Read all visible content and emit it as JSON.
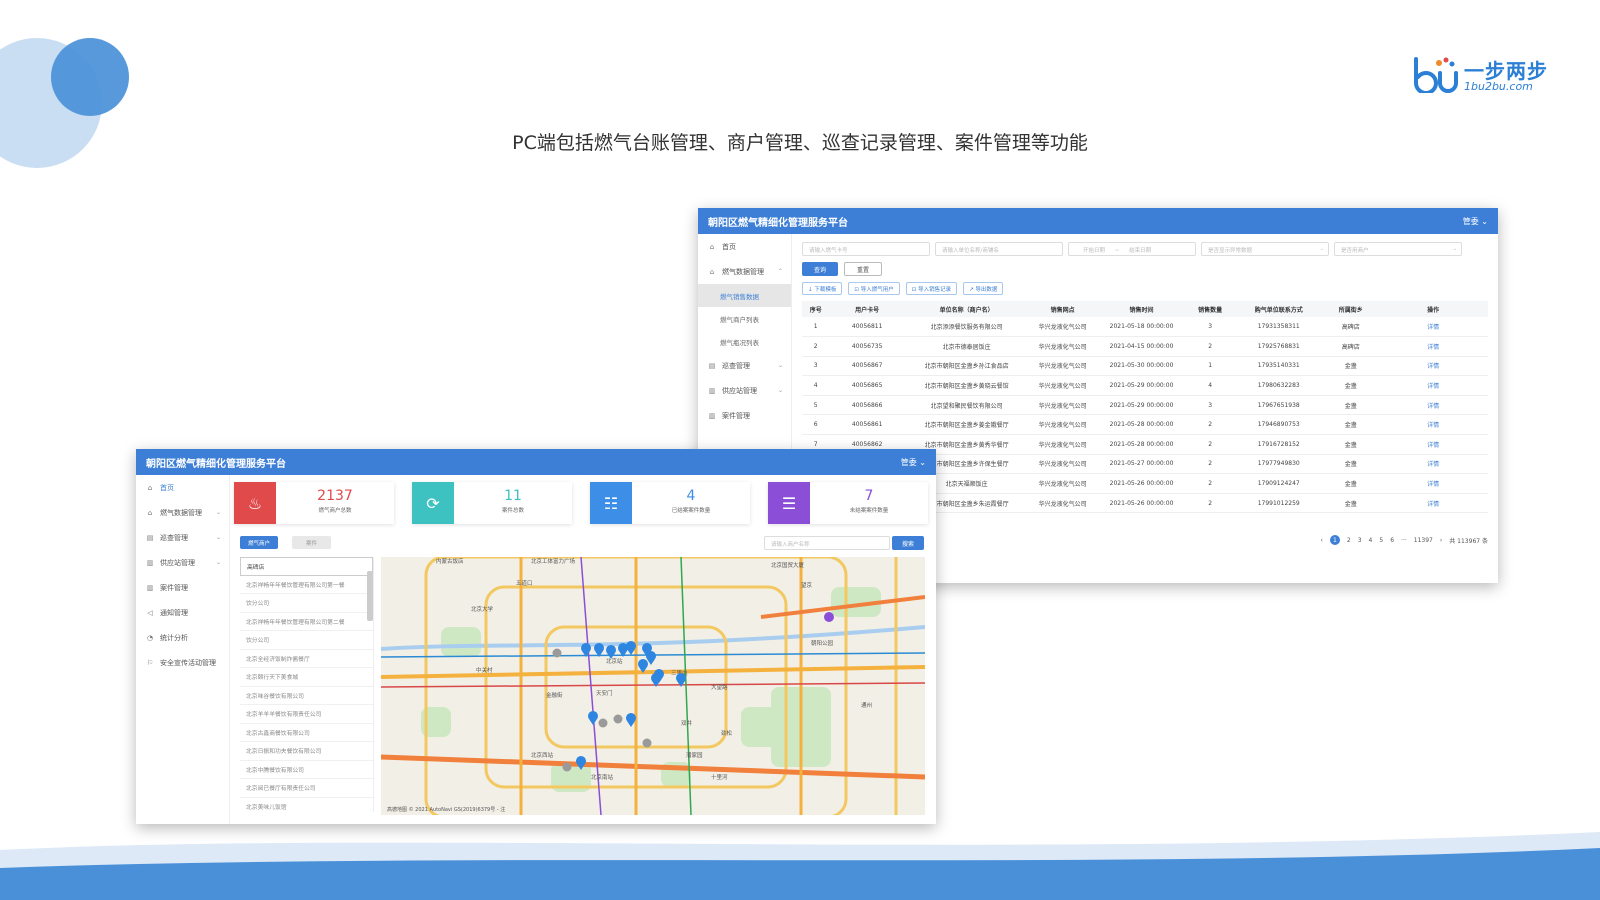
{
  "headline": "PC端包括燃气台账管理、商户管理、巡查记录管理、案件管理等功能",
  "logo": {
    "cn": "一步两步",
    "en": "1bu2bu.com"
  },
  "back_window": {
    "title": "朝阳区燃气精细化管理服务平台",
    "user": "管委 ⌄",
    "sidebar": {
      "items": [
        {
          "icon": "⌂",
          "label": "首页"
        },
        {
          "icon": "⌂",
          "label": "燃气数据管理",
          "chev": "⌃"
        }
      ],
      "subs": [
        "燃气销售数据",
        "燃气商户列表",
        "燃气瓶况列表"
      ],
      "more": [
        {
          "icon": "▤",
          "label": "巡查管理",
          "chev": "⌄"
        },
        {
          "icon": "▥",
          "label": "供应站管理",
          "chev": "⌄"
        },
        {
          "icon": "▥",
          "label": "案件管理",
          "chev": ""
        }
      ]
    },
    "filters": [
      "请输入燃气卡号",
      "请输入单位名称/商铺名",
      "开始日期",
      "~",
      "结束日期",
      "是否显示异常数据",
      "是否用商户"
    ],
    "buttons": {
      "query": "查询",
      "reset": "重置"
    },
    "actions": [
      "↓ 下载模板",
      "⊡ 导入燃气用户",
      "⊡ 导入销售记录",
      "↗ 导出数据"
    ],
    "table": {
      "headers": [
        "序号",
        "用户卡号",
        "单位名称（商户名）",
        "销售网点",
        "销售时间",
        "销售数量",
        "购气单位联系方式",
        "所属街乡",
        "操作"
      ],
      "rows": [
        [
          "1",
          "40056811",
          "北京添添餐饮服务有限公司",
          "华兴龙液化气公司",
          "2021-05-18 00:00:00",
          "3",
          "17931358311",
          "高碑店",
          "详情"
        ],
        [
          "2",
          "40056735",
          "北京市德泰居饭庄",
          "华兴龙液化气公司",
          "2021-04-15 00:00:00",
          "2",
          "17925768831",
          "高碑店",
          "详情"
        ],
        [
          "3",
          "40056867",
          "北京市朝阳区金盏乡孙江食品店",
          "华兴龙液化气公司",
          "2021-05-30 00:00:00",
          "1",
          "17935140331",
          "金盏",
          "详情"
        ],
        [
          "4",
          "40056865",
          "北京市朝阳区金盏乡黄晓云餐馆",
          "华兴龙液化气公司",
          "2021-05-29 00:00:00",
          "4",
          "17980632283",
          "金盏",
          "详情"
        ],
        [
          "5",
          "40056866",
          "北京望和聚民餐饮有限公司",
          "华兴龙液化气公司",
          "2021-05-29 00:00:00",
          "3",
          "17967651938",
          "金盏",
          "详情"
        ],
        [
          "6",
          "40056861",
          "北京市朝阳区金盏乡姜金娥餐厅",
          "华兴龙液化气公司",
          "2021-05-28 00:00:00",
          "2",
          "17946890753",
          "金盏",
          "详情"
        ],
        [
          "7",
          "40056862",
          "北京市朝阳区金盏乡黄秀华餐厅",
          "华兴龙液化气公司",
          "2021-05-28 00:00:00",
          "2",
          "17916728152",
          "金盏",
          "详情"
        ],
        [
          "8",
          "40056860",
          "北京市朝阳区金盏乡许保生餐厅",
          "华兴龙液化气公司",
          "2021-05-27 00:00:00",
          "2",
          "17977949830",
          "金盏",
          "详情"
        ],
        [
          "9",
          "40056858",
          "北京天福顺饭庄",
          "华兴龙液化气公司",
          "2021-05-26 00:00:00",
          "2",
          "17909124247",
          "金盏",
          "详情"
        ],
        [
          "10",
          "40056859",
          "北京市朝阳区金盏乡朱运霞餐厅",
          "华兴龙液化气公司",
          "2021-05-26 00:00:00",
          "2",
          "17991012259",
          "金盏",
          "详情"
        ]
      ]
    },
    "pager": {
      "prev": "‹",
      "current": "1",
      "pages": [
        "2",
        "3",
        "4",
        "5",
        "6"
      ],
      "ellipsis": "···",
      "last": "11397",
      "next": "›",
      "total": "共 113967 条"
    }
  },
  "front_window": {
    "title": "朝阳区燃气精细化管理服务平台",
    "user": "管委 ⌄",
    "sidebar": [
      {
        "icon": "⌂",
        "label": "首页",
        "chev": "",
        "active": true
      },
      {
        "icon": "⌂",
        "label": "燃气数据管理",
        "chev": "⌄"
      },
      {
        "icon": "▤",
        "label": "巡查管理",
        "chev": "⌄"
      },
      {
        "icon": "▥",
        "label": "供应站管理",
        "chev": "⌄"
      },
      {
        "icon": "▥",
        "label": "案件管理",
        "chev": ""
      },
      {
        "icon": "◁",
        "label": "通知管理",
        "chev": ""
      },
      {
        "icon": "◔",
        "label": "统计分析",
        "chev": ""
      },
      {
        "icon": "⚐",
        "label": "安全宣传活动管理",
        "chev": ""
      }
    ],
    "cards": [
      {
        "value": "2137",
        "label": "燃气商户总数",
        "color": "#e04a4a",
        "value_color": "#e04a4a",
        "icon": "flame-icon",
        "glyph": "♨"
      },
      {
        "value": "11",
        "label": "案件总数",
        "color": "#3dc1c1",
        "value_color": "#3dc1c1",
        "icon": "case-icon",
        "glyph": "⟳"
      },
      {
        "value": "4",
        "label": "已结案案件数量",
        "color": "#3d8ee6",
        "value_color": "#3d8ee6",
        "icon": "document-check-icon",
        "glyph": "☷"
      },
      {
        "value": "7",
        "label": "未结案案件数量",
        "color": "#8a4fd6",
        "value_color": "#8a4fd6",
        "icon": "clipboard-icon",
        "glyph": "☰"
      }
    ],
    "tabs": {
      "merchants": "燃气商户",
      "cases": "案件"
    },
    "search": {
      "placeholder": "请输入商户名称",
      "button": "搜索"
    },
    "list": [
      "高碑店",
      "北京祥畅年年餐饮管理有限公司第一餐",
      "饮分公司",
      "北京祥畅年年餐饮管理有限公司第二餐",
      "饮分公司",
      "北京全经济饭制炸酱餐厅",
      "北京颐行天下美食城",
      "北京味谷餐饮有限公司",
      "北京羊羊羊餐饮有限责任公司",
      "北京古鑫商餐饮有限公司",
      "北京日振和功夫餐饮有限公司",
      "北京中腾餐饮有限公司",
      "北京阅已餐厅有限责任公司",
      "北京美味儿饭馆"
    ],
    "map": {
      "labels": [
        "内蒙古饭店",
        "北京工体富力广场",
        "北京国贸大厦",
        "五道口",
        "北京站",
        "朝阳公园",
        "北京大学",
        "中关村",
        "天安门",
        "北京南站",
        "北京西站",
        "望京",
        "三里屯",
        "大望路",
        "双井",
        "劲松",
        "潘家园",
        "十里河",
        "金融街",
        "通州"
      ],
      "copyright": "高德地图 © 2021 AutoNavi GS(2019)6379号 - 注"
    }
  }
}
